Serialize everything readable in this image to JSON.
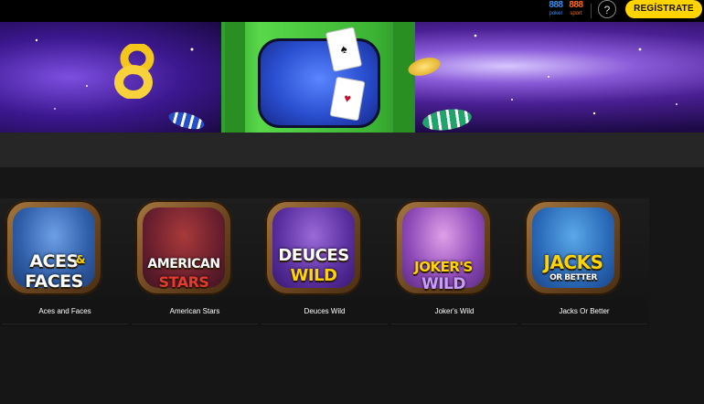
{
  "header": {
    "brands": [
      {
        "num": "888",
        "label": "poker"
      },
      {
        "num": "888",
        "label": "sport"
      }
    ],
    "help_label": "?",
    "register_label": "REGÍSTRATE"
  },
  "games": [
    {
      "label": "Aces and Faces",
      "title_line1": "ACES",
      "amp": "&",
      "title_line2": "FACES"
    },
    {
      "label": "American Stars",
      "title_line1": "AMERICAN",
      "title_line2": "STARS"
    },
    {
      "label": "Deuces Wild",
      "title_line1": "DEUCES",
      "title_line2": "WILD"
    },
    {
      "label": "Joker's Wild",
      "title_line1": "JOKER'S",
      "title_line2": "WILD"
    },
    {
      "label": "Jacks Or Better",
      "title_line1": "JACKS",
      "title_line2": "OR BETTER"
    }
  ],
  "colors": {
    "accent_yellow": "#ffd400",
    "poker_blue": "#3b8df1",
    "sport_orange": "#ff6b1a",
    "page_bg": "#161616"
  }
}
